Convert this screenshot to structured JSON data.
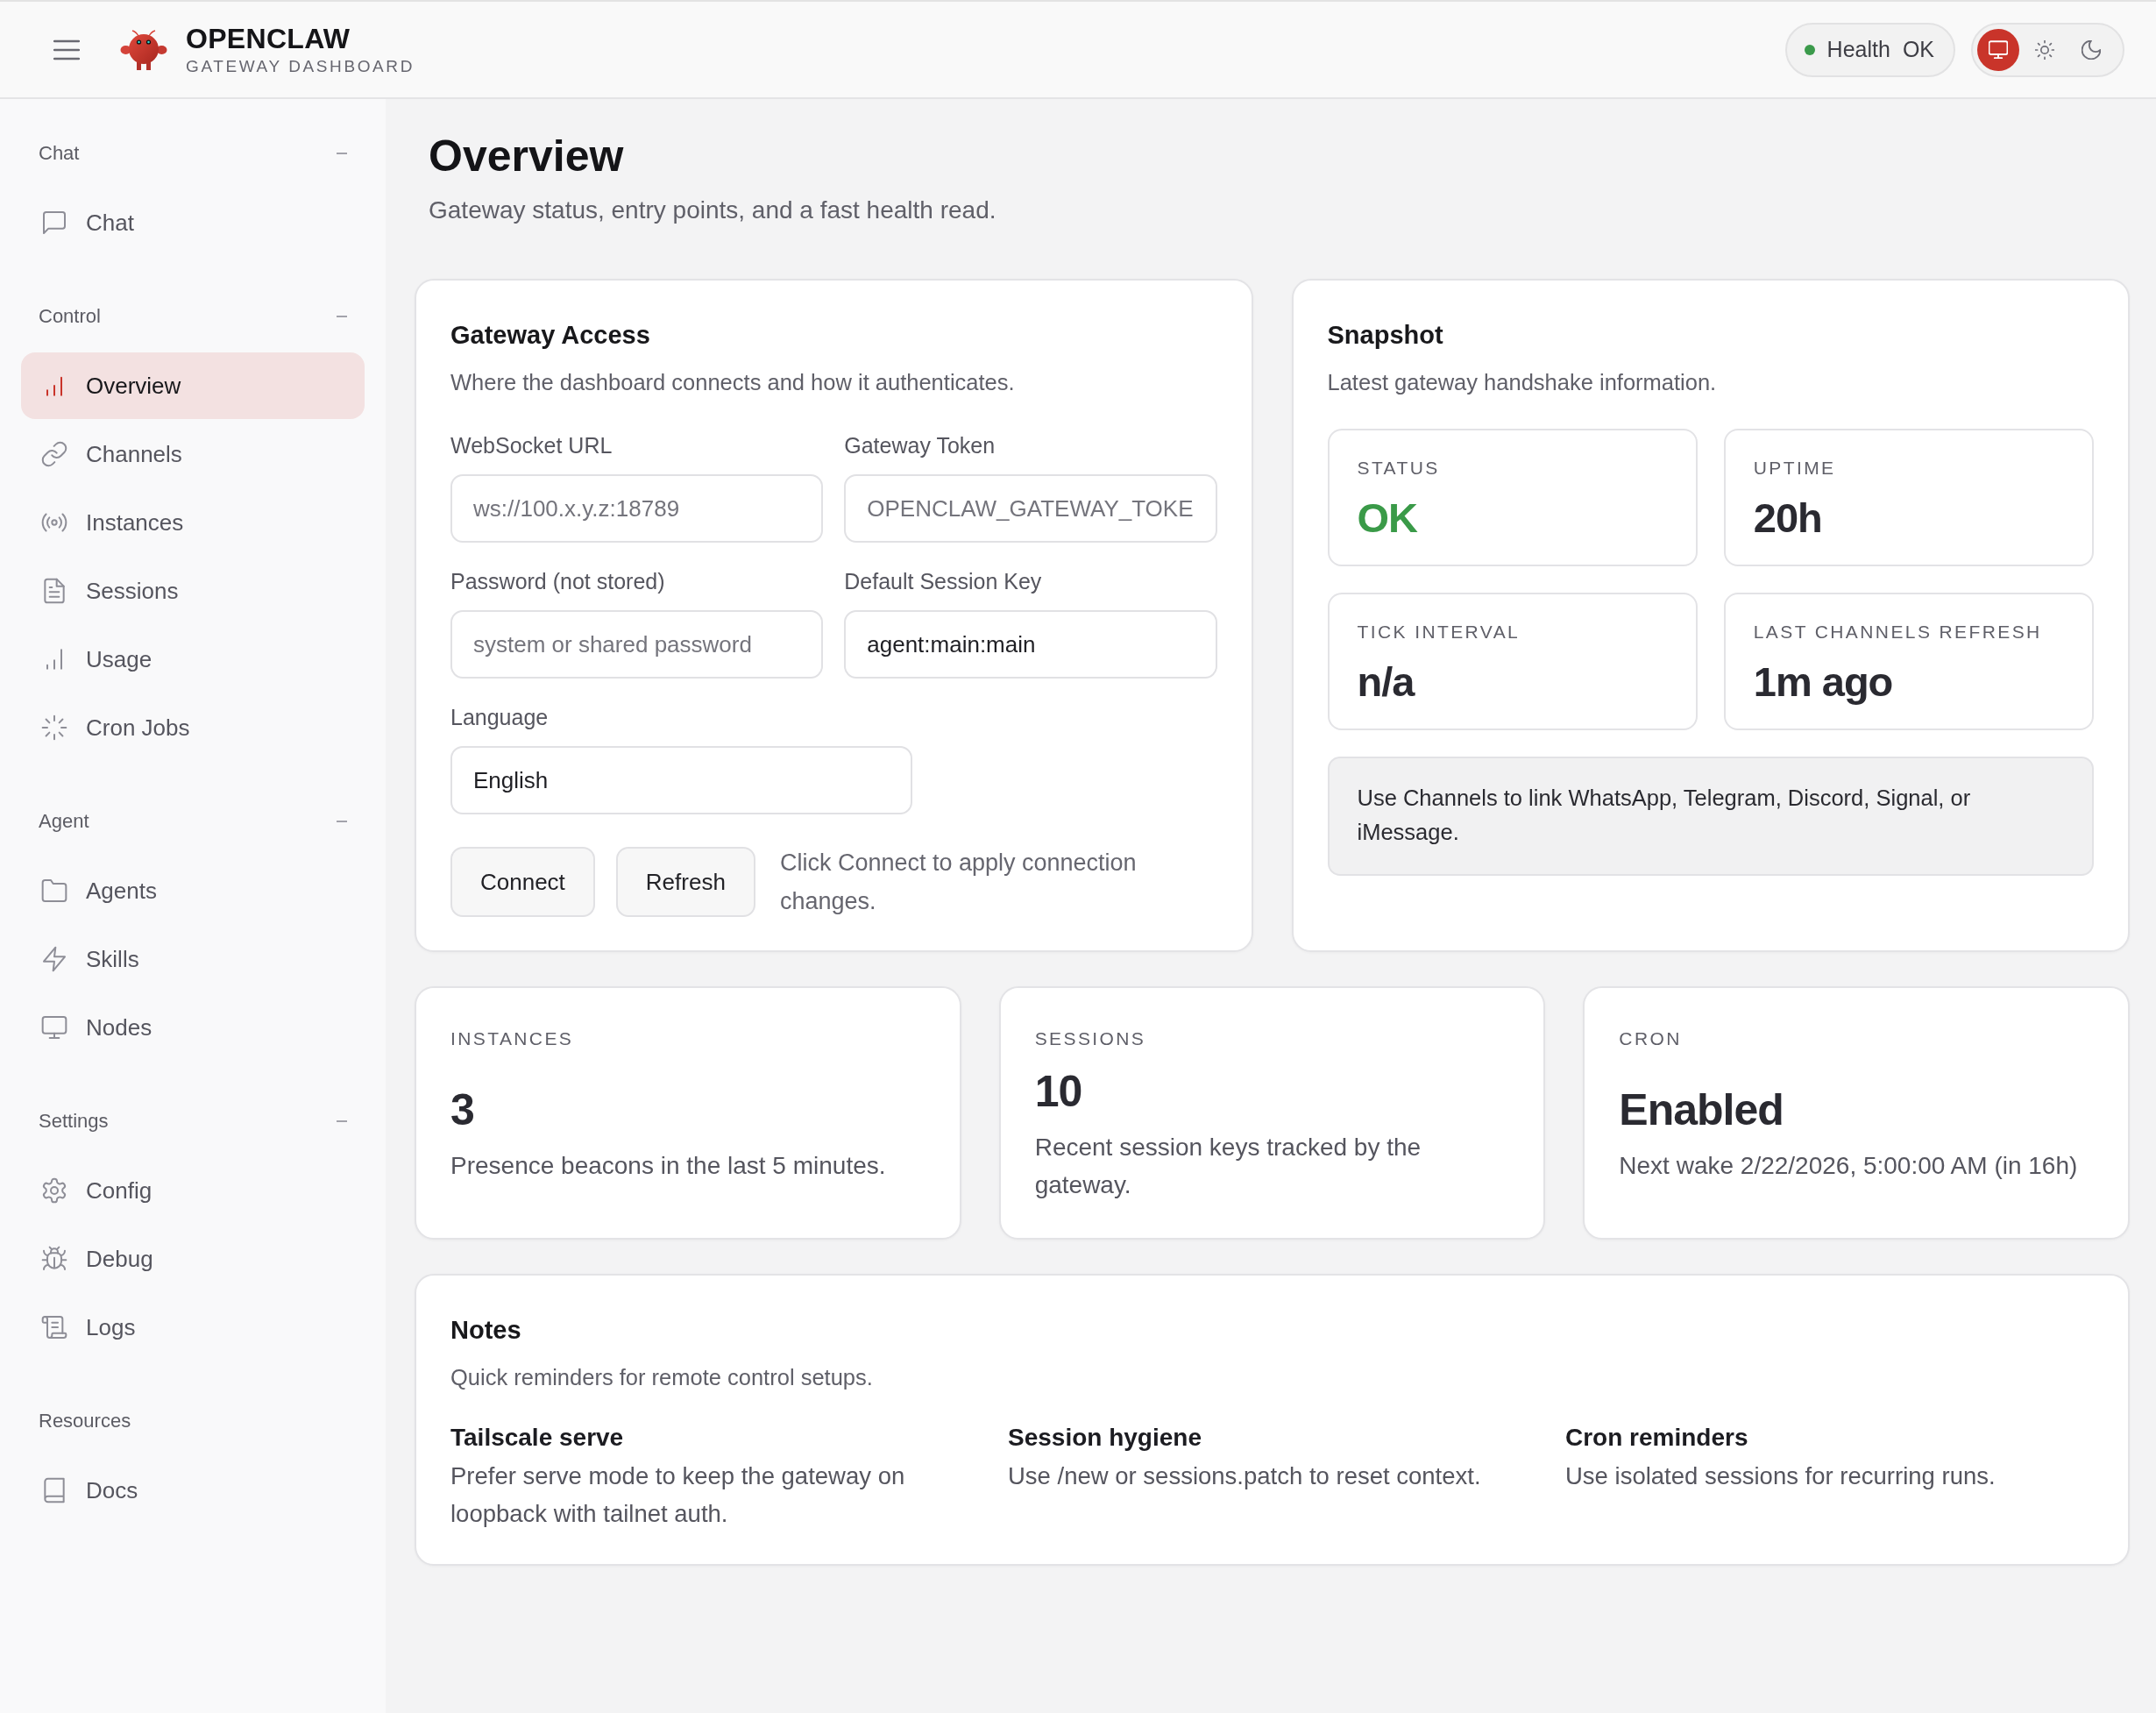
{
  "header": {
    "brand": {
      "name": "OPENCLAW",
      "subtitle": "GATEWAY DASHBOARD"
    },
    "health": {
      "label": "Health",
      "value": "OK",
      "healthy": true
    },
    "theme_options": [
      {
        "kind": "system",
        "selected": true
      },
      {
        "kind": "light",
        "selected": false
      },
      {
        "kind": "dark",
        "selected": false
      }
    ]
  },
  "sidebar": {
    "groups": [
      {
        "label": "Chat",
        "collapsible": true,
        "items": [
          {
            "label": "Chat",
            "selected": false
          }
        ]
      },
      {
        "label": "Control",
        "collapsible": true,
        "items": [
          {
            "label": "Overview",
            "selected": true
          },
          {
            "label": "Channels",
            "selected": false
          },
          {
            "label": "Instances",
            "selected": false
          },
          {
            "label": "Sessions",
            "selected": false
          },
          {
            "label": "Usage",
            "selected": false
          },
          {
            "label": "Cron Jobs",
            "selected": false
          }
        ]
      },
      {
        "label": "Agent",
        "collapsible": true,
        "items": [
          {
            "label": "Agents",
            "selected": false
          },
          {
            "label": "Skills",
            "selected": false
          },
          {
            "label": "Nodes",
            "selected": false
          }
        ]
      },
      {
        "label": "Settings",
        "collapsible": true,
        "items": [
          {
            "label": "Config",
            "selected": false
          },
          {
            "label": "Debug",
            "selected": false
          },
          {
            "label": "Logs",
            "selected": false
          }
        ]
      },
      {
        "label": "Resources",
        "collapsible": false,
        "items": [
          {
            "label": "Docs",
            "selected": false
          }
        ]
      }
    ]
  },
  "page": {
    "title": "Overview",
    "subtitle": "Gateway status, entry points, and a fast health read."
  },
  "gateway_access": {
    "title": "Gateway Access",
    "description": "Where the dashboard connects and how it authenticates.",
    "fields": [
      {
        "label": "WebSocket URL",
        "placeholder": "ws://100.x.y.z:18789"
      },
      {
        "label": "Gateway Token",
        "placeholder": "OPENCLAW_GATEWAY_TOKE"
      },
      {
        "label": "Password (not stored)",
        "placeholder": "system or shared password"
      },
      {
        "label": "Default Session Key",
        "value": "agent:main:main"
      }
    ],
    "language": {
      "label": "Language",
      "value": "English"
    },
    "buttons": [
      "Connect",
      "Refresh"
    ],
    "hint": "Click Connect to apply connection changes."
  },
  "snapshot": {
    "title": "Snapshot",
    "description": "Latest gateway handshake information.",
    "stats": [
      {
        "label": "STATUS",
        "value": "OK",
        "positive": true
      },
      {
        "label": "UPTIME",
        "value": "20h",
        "positive": false
      },
      {
        "label": "TICK INTERVAL",
        "value": "n/a",
        "positive": false
      },
      {
        "label": "LAST CHANNELS REFRESH",
        "value": "1m ago",
        "positive": false
      }
    ],
    "callout": "Use Channels to link WhatsApp, Telegram, Discord, Signal, or iMessage."
  },
  "summary_cards": [
    {
      "label": "INSTANCES",
      "value": "3",
      "description": "Presence beacons in the last 5 minutes."
    },
    {
      "label": "SESSIONS",
      "value": "10",
      "description": "Recent session keys tracked by the gateway."
    },
    {
      "label": "CRON",
      "value": "Enabled",
      "description": "Next wake 2/22/2026, 5:00:00 AM (in 16h)"
    }
  ],
  "notes": {
    "title": "Notes",
    "description": "Quick reminders for remote control setups.",
    "items": [
      {
        "title": "Tailscale serve",
        "text": "Prefer serve mode to keep the gateway on loopback with tailnet auth."
      },
      {
        "title": "Session hygiene",
        "text": "Use /new or sessions.patch to reset context."
      },
      {
        "title": "Cron reminders",
        "text": "Use isolated sessions for recurring runs."
      }
    ]
  }
}
